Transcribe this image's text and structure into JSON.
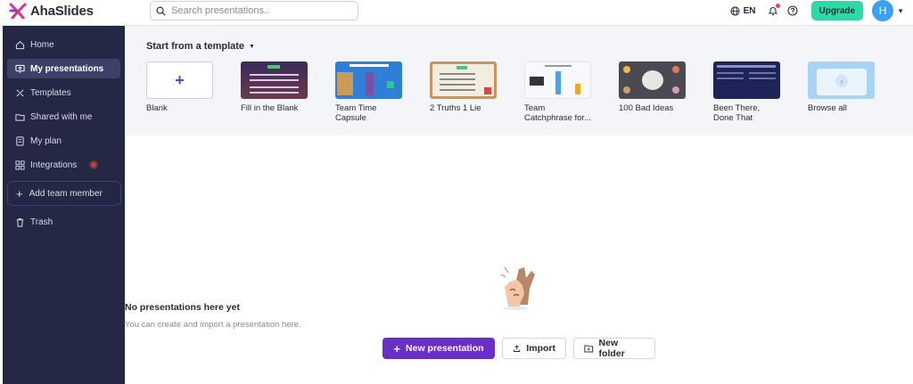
{
  "app": {
    "name": "AhaSlides"
  },
  "search": {
    "placeholder": "Search presentations.."
  },
  "topbar": {
    "language": "EN",
    "upgrade_label": "Upgrade",
    "avatar_initial": "H"
  },
  "sidebar": {
    "items": [
      {
        "label": "Home",
        "icon": "home-icon"
      },
      {
        "label": "My presentations",
        "icon": "presentation-icon",
        "active": true
      },
      {
        "label": "Templates",
        "icon": "templates-icon"
      },
      {
        "label": "Shared with me",
        "icon": "shared-folder-icon"
      },
      {
        "label": "My plan",
        "icon": "plan-icon"
      },
      {
        "label": "Integrations",
        "icon": "integrations-icon"
      }
    ],
    "add_member_label": "Add team member",
    "trash_label": "Trash"
  },
  "templates": {
    "title": "Start from a template",
    "items": [
      {
        "label": "Blank"
      },
      {
        "label": "Fill in the Blank"
      },
      {
        "label": "Team Time Capsule"
      },
      {
        "label": "2 Truths 1 Lie"
      },
      {
        "label": "Team Catchphrase for..."
      },
      {
        "label": "100 Bad Ideas"
      },
      {
        "label": "Been There, Done That"
      },
      {
        "label": "Browse all"
      }
    ]
  },
  "empty_state": {
    "title": "No presentations here yet",
    "subtitle": "You can create and import a presentation here."
  },
  "actions": {
    "new_presentation": "New presentation",
    "import": "Import",
    "new_folder": "New folder"
  },
  "colors": {
    "sidebar_bg": "#252845",
    "primary": "#6a2fc8",
    "upgrade": "#2fd8a8",
    "avatar": "#3aa0f0"
  }
}
